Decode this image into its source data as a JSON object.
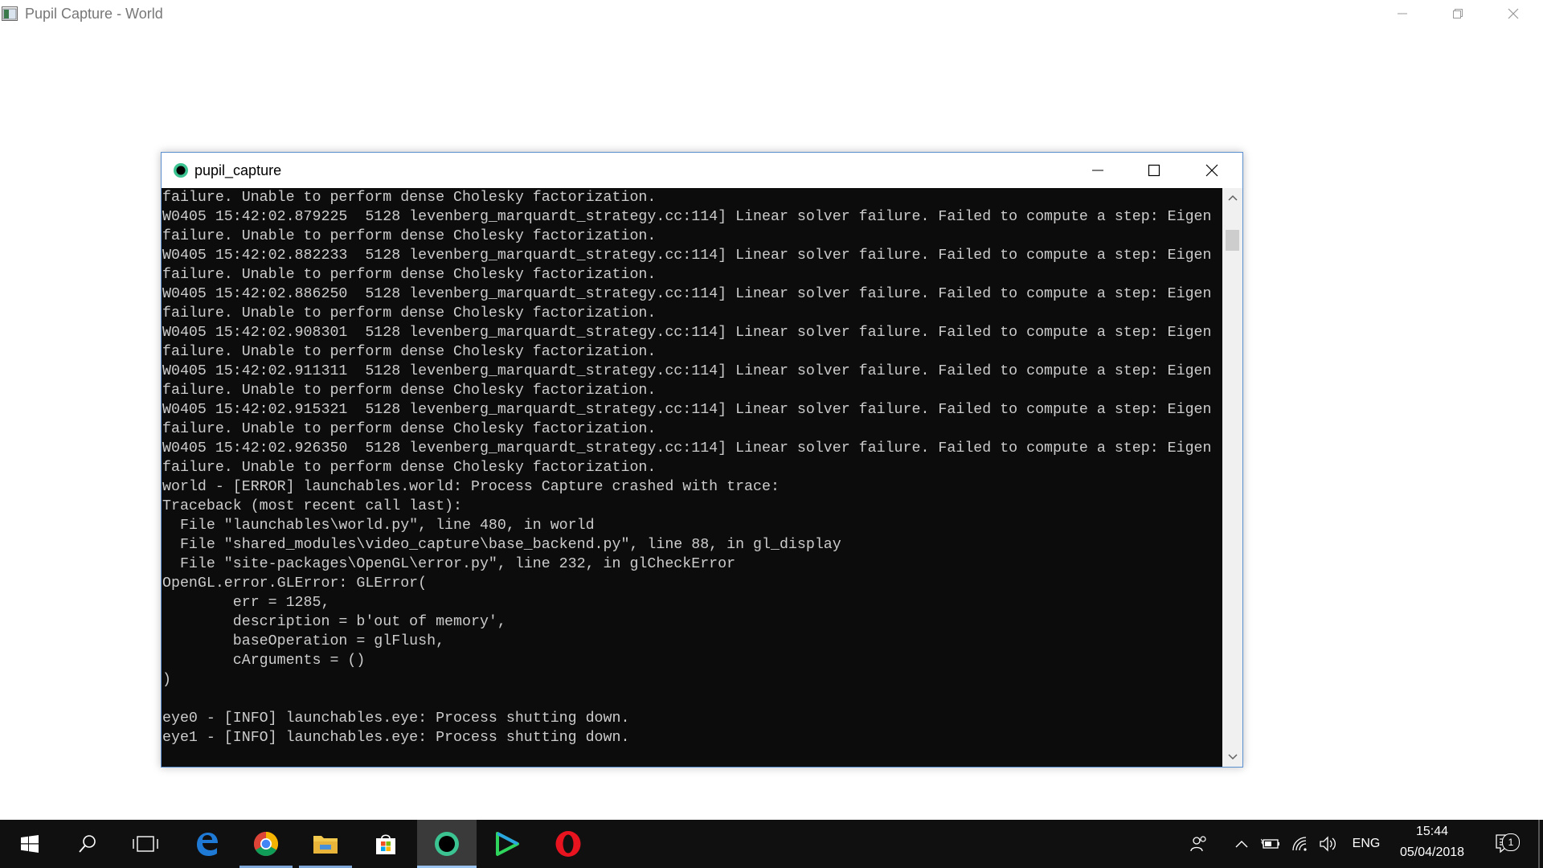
{
  "outer_window": {
    "title": "Pupil Capture - World"
  },
  "console_window": {
    "title": "pupil_capture",
    "lines": [
      "failure. Unable to perform dense Cholesky factorization.",
      "W0405 15:42:02.879225  5128 levenberg_marquardt_strategy.cc:114] Linear solver failure. Failed to compute a step: Eigen",
      "failure. Unable to perform dense Cholesky factorization.",
      "W0405 15:42:02.882233  5128 levenberg_marquardt_strategy.cc:114] Linear solver failure. Failed to compute a step: Eigen",
      "failure. Unable to perform dense Cholesky factorization.",
      "W0405 15:42:02.886250  5128 levenberg_marquardt_strategy.cc:114] Linear solver failure. Failed to compute a step: Eigen",
      "failure. Unable to perform dense Cholesky factorization.",
      "W0405 15:42:02.908301  5128 levenberg_marquardt_strategy.cc:114] Linear solver failure. Failed to compute a step: Eigen",
      "failure. Unable to perform dense Cholesky factorization.",
      "W0405 15:42:02.911311  5128 levenberg_marquardt_strategy.cc:114] Linear solver failure. Failed to compute a step: Eigen",
      "failure. Unable to perform dense Cholesky factorization.",
      "W0405 15:42:02.915321  5128 levenberg_marquardt_strategy.cc:114] Linear solver failure. Failed to compute a step: Eigen",
      "failure. Unable to perform dense Cholesky factorization.",
      "W0405 15:42:02.926350  5128 levenberg_marquardt_strategy.cc:114] Linear solver failure. Failed to compute a step: Eigen",
      "failure. Unable to perform dense Cholesky factorization.",
      "world - [ERROR] launchables.world: Process Capture crashed with trace:",
      "Traceback (most recent call last):",
      "  File \"launchables\\world.py\", line 480, in world",
      "  File \"shared_modules\\video_capture\\base_backend.py\", line 88, in gl_display",
      "  File \"site-packages\\OpenGL\\error.py\", line 232, in glCheckError",
      "OpenGL.error.GLError: GLError(",
      "        err = 1285,",
      "        description = b'out of memory',",
      "        baseOperation = glFlush,",
      "        cArguments = ()",
      ")",
      "",
      "eye0 - [INFO] launchables.eye: Process shutting down.",
      "eye1 - [INFO] launchables.eye: Process shutting down."
    ]
  },
  "taskbar": {
    "items": [
      {
        "name": "start-button",
        "icon": "windows-logo-icon"
      },
      {
        "name": "search-button",
        "icon": "search-icon"
      },
      {
        "name": "task-view-button",
        "icon": "task-view-icon"
      },
      {
        "name": "edge-button",
        "icon": "edge-icon"
      },
      {
        "name": "chrome-button",
        "icon": "chrome-icon"
      },
      {
        "name": "file-explorer-button",
        "icon": "folder-icon"
      },
      {
        "name": "store-button",
        "icon": "store-icon"
      },
      {
        "name": "pupil-capture-button",
        "icon": "pupil-icon"
      },
      {
        "name": "play-button",
        "icon": "play-icon"
      },
      {
        "name": "opera-button",
        "icon": "opera-icon"
      }
    ],
    "language": "ENG",
    "time": "15:44",
    "date": "05/04/2018",
    "notification_count": "1"
  },
  "colors": {
    "console_bg": "#0c0c0c",
    "console_fg": "#cccccc",
    "window_border": "#5b8fd0",
    "taskbar_bg": "#101010"
  }
}
